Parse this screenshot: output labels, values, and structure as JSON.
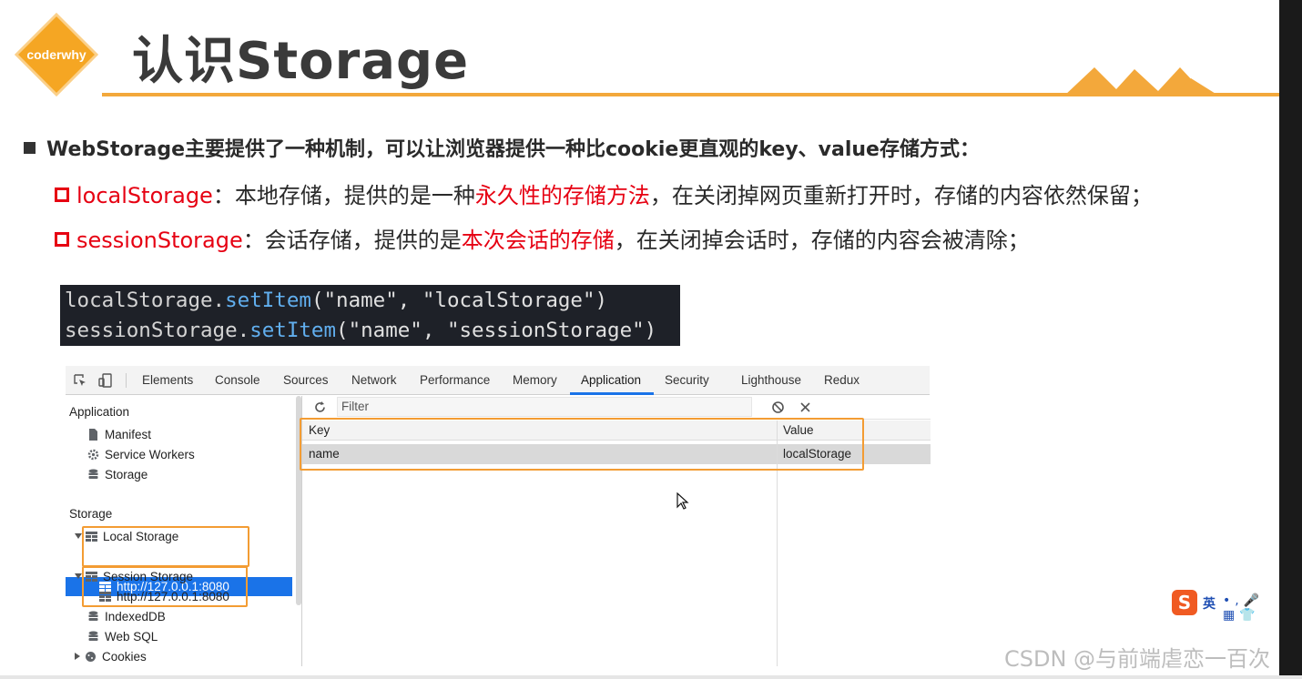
{
  "logo": {
    "text": "coderwhy",
    "color": "#f5a623"
  },
  "header": {
    "title": "认识Storage",
    "accent_color": "#f3a83b"
  },
  "bullets": {
    "main": "WebStorage主要提供了一种机制，可以让浏览器提供一种比cookie更直观的key、value存储方式：",
    "local": {
      "name": "localStorage",
      "pre": "：本地存储，提供的是一种",
      "highlight": "永久性的存储方法",
      "post": "，在关闭掉网页重新打开时，存储的内容依然保留；"
    },
    "session": {
      "name": "sessionStorage",
      "pre": "：会话存储，提供的是",
      "highlight": "本次会话的存储",
      "post": "，在关闭掉会话时，存储的内容会被清除；"
    },
    "highlight_color": "#e60012"
  },
  "code": {
    "line1": {
      "obj": "localStorage.",
      "fn": "setItem",
      "args": "(\"name\", \"localStorage\")"
    },
    "line2": {
      "obj": "sessionStorage.",
      "fn": "setItem",
      "args": "(\"name\", \"sessionStorage\")"
    }
  },
  "devtools": {
    "tabs": [
      "Elements",
      "Console",
      "Sources",
      "Network",
      "Performance",
      "Memory",
      "Application",
      "Security",
      "Lighthouse",
      "Redux"
    ],
    "active_tab": "Application",
    "sidebar": {
      "app_header": "Application",
      "app_items": [
        "Manifest",
        "Service Workers",
        "Storage"
      ],
      "storage_header": "Storage",
      "local_storage": "Local Storage",
      "local_origin": "http://127.0.0.1:8080",
      "session_storage": "Session Storage",
      "session_origin": "http://127.0.0.1:8080",
      "other_items": [
        "IndexedDB",
        "Web SQL",
        "Cookies"
      ]
    },
    "filter_placeholder": "Filter",
    "table": {
      "headers": [
        "Key",
        "Value"
      ],
      "rows": [
        {
          "key": "name",
          "value": "localStorage"
        }
      ]
    }
  },
  "ime": {
    "lang": "英"
  },
  "watermark": "CSDN @与前端虐恋一百次"
}
